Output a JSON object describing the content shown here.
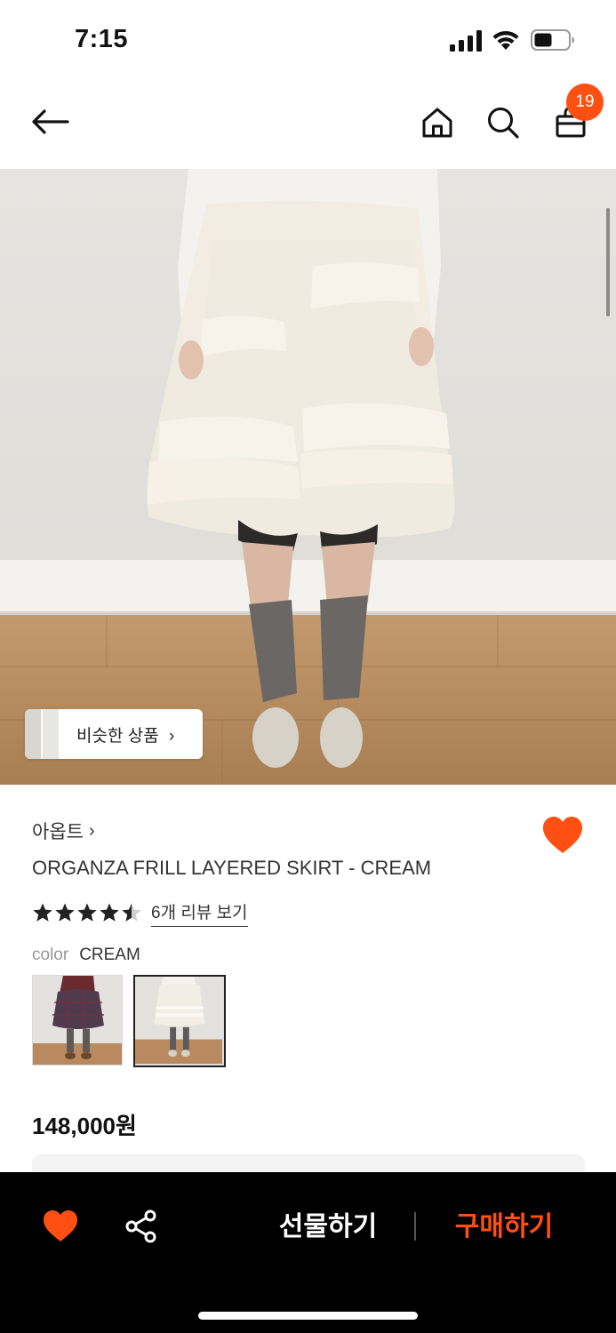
{
  "status_bar": {
    "time": "7:15"
  },
  "nav": {
    "icons": [
      "arrow-left-icon",
      "home-icon",
      "search-icon",
      "shopping-bag-icon"
    ],
    "cart_count": "19"
  },
  "hero": {
    "similar_products_label": "비슷한 상품",
    "similar_chevron": "›"
  },
  "product": {
    "brand": "아옵트",
    "brand_chevron": "›",
    "title": "ORGANZA FRILL LAYERED SKIRT - CREAM",
    "rating": 4.5,
    "rating_max": 5,
    "review_link": "6개 리뷰 보기",
    "option_label": "color",
    "option_value": "CREAM",
    "swatches": [
      "swatch-plaid",
      "swatch-cream"
    ],
    "selected_swatch_index": 1,
    "price": "148,000원"
  },
  "bottom_bar": {
    "gift_label": "선물하기",
    "buy_label": "구매하기"
  },
  "colors": {
    "accent": "#ff4f12",
    "bottom_bar_bg": "#000000"
  }
}
